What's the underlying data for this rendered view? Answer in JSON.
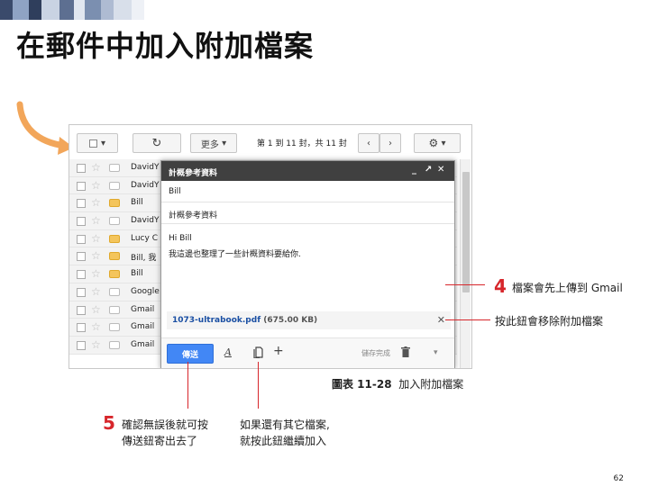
{
  "slide": {
    "title": "在郵件中加入附加檔案",
    "page_number": "62",
    "caption_label": "圖表 11-28",
    "caption_text": "加入附加檔案"
  },
  "toolbar": {
    "more_label": "更多",
    "pager_text": "第 1 到 11 封，共 11 封"
  },
  "inbox": {
    "rows": [
      {
        "sender": "DavidY",
        "important": false
      },
      {
        "sender": "DavidY",
        "important": false
      },
      {
        "sender": "Bill",
        "important": true
      },
      {
        "sender": "DavidY",
        "important": false
      },
      {
        "sender": "Lucy C",
        "important": true
      },
      {
        "sender": "Bill, 我",
        "important": true
      },
      {
        "sender": "Bill",
        "important": true
      },
      {
        "sender": "Google",
        "important": false
      },
      {
        "sender": "Gmail",
        "important": false
      },
      {
        "sender": "Gmail",
        "important": false
      },
      {
        "sender": "Gmail",
        "important": false
      }
    ]
  },
  "compose": {
    "header_title": "計概參考資料",
    "header_controls": [
      "_",
      "↗",
      "✕"
    ],
    "to": "Bill",
    "subject": "計概參考資料",
    "greeting": "Hi Bill",
    "body": "我這邊也整理了一些計概資料要給你.",
    "attachment_name": "1073-ultrabook.pdf",
    "attachment_size": "(675.00 KB)",
    "send_label": "傳送",
    "saved_status": "儲存完成"
  },
  "annotations": {
    "callout4_num": "4",
    "callout4_text": "檔案會先上傳到 Gmail",
    "remove_text": "按此鈕會移除附加檔案",
    "callout5_num": "5",
    "callout5_line1": "確認無誤後就可按",
    "callout5_line2": "傳送鈕寄出去了",
    "more_files_line1": "如果還有其它檔案,",
    "more_files_line2": "就按此鈕繼續加入"
  },
  "colors": {
    "accent_red": "#d7262b",
    "send_blue": "#4287f5",
    "important_tag": "#f4c55c",
    "compose_header": "#404040"
  }
}
